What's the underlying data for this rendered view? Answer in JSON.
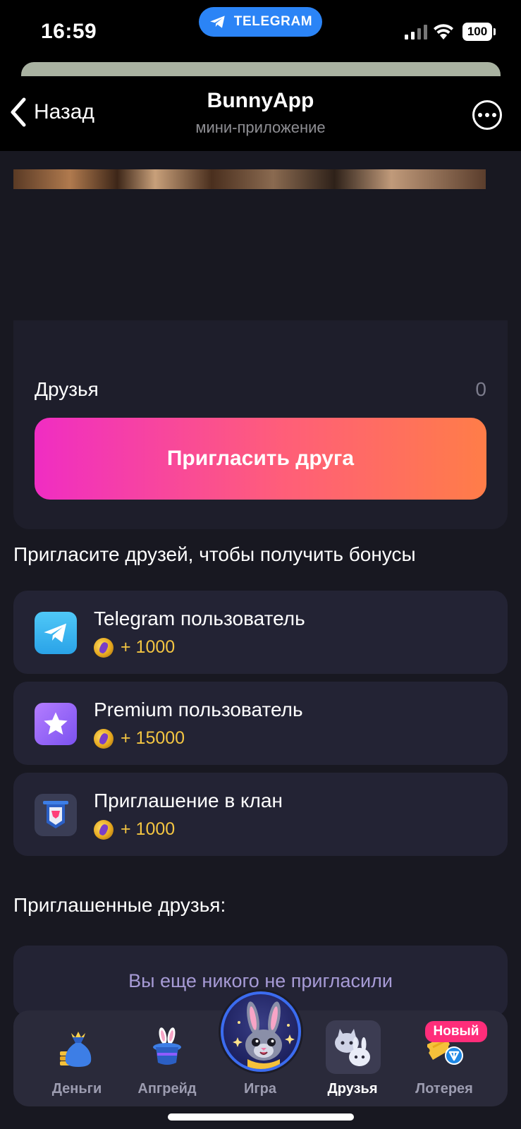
{
  "status_bar": {
    "time": "16:59",
    "telegram_pill": "TELEGRAM",
    "battery": "100"
  },
  "header": {
    "back_label": "Назад",
    "title": "BunnyApp",
    "subtitle": "мини-приложение"
  },
  "friends_card": {
    "label": "Друзья",
    "count": "0",
    "invite_button": "Пригласить друга"
  },
  "bonuses": {
    "section_title": "Пригласите друзей, чтобы получить бонусы",
    "items": [
      {
        "title": "Telegram пользователь",
        "reward": "+ 1000",
        "icon": "telegram-icon"
      },
      {
        "title": "Premium пользователь",
        "reward": "+ 15000",
        "icon": "premium-star-icon"
      },
      {
        "title": "Приглашение в клан",
        "reward": "+ 1000",
        "icon": "clan-banner-icon"
      }
    ]
  },
  "invited": {
    "section_title": "Приглашенные друзья:",
    "empty_text": "Вы еще никого не пригласили"
  },
  "nav": {
    "items": [
      {
        "label": "Деньги",
        "icon": "money-bag-icon"
      },
      {
        "label": "Апгрейд",
        "icon": "magic-hat-icon"
      },
      {
        "label": "Игра",
        "icon": "bunny-avatar-icon"
      },
      {
        "label": "Друзья",
        "icon": "friends-icon",
        "active": true
      },
      {
        "label": "Лотерея",
        "icon": "lottery-ticket-icon"
      }
    ],
    "new_badge": "Новый"
  },
  "colors": {
    "accent_gradient_start": "#f02dc3",
    "accent_gradient_end": "#ff7d48",
    "reward": "#f3c542",
    "bg": "#181821",
    "card": "#232334"
  }
}
